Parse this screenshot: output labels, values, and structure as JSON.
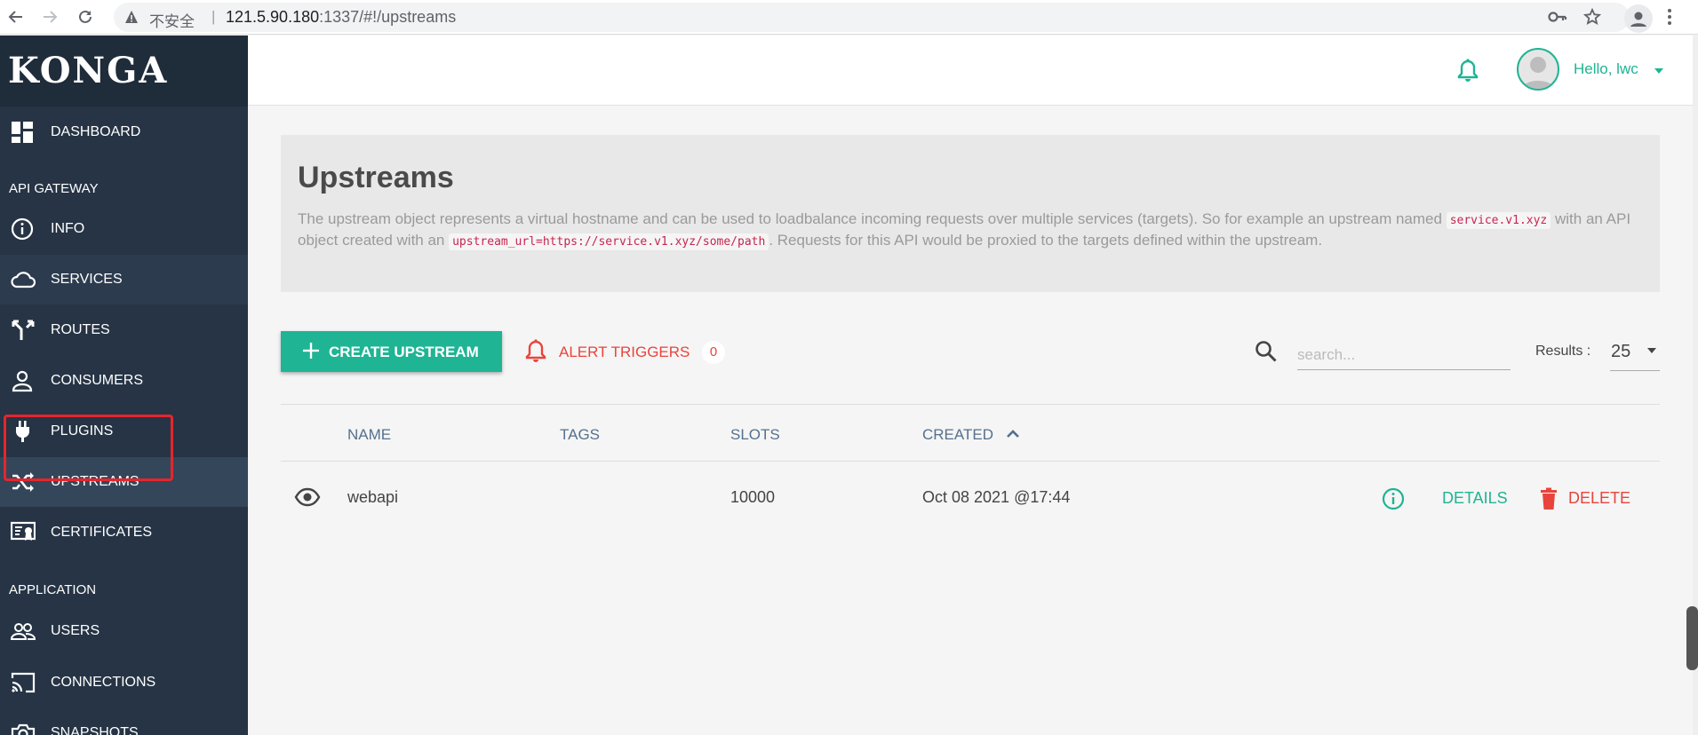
{
  "browser": {
    "insecure_label": "不安全",
    "separator": "|",
    "url_host": "121.5.90.180",
    "url_rest": ":1337/#!/upstreams"
  },
  "sidebar": {
    "logo": "KONGA",
    "dashboard": {
      "label": "DASHBOARD",
      "icon": "dashboard-icon"
    },
    "section_api_gateway": "API GATEWAY",
    "api_items": [
      {
        "label": "INFO",
        "icon": "info-icon"
      },
      {
        "label": "SERVICES",
        "icon": "cloud-icon"
      },
      {
        "label": "ROUTES",
        "icon": "route-fork-icon"
      },
      {
        "label": "CONSUMERS",
        "icon": "person-icon"
      },
      {
        "label": "PLUGINS",
        "icon": "plug-icon"
      },
      {
        "label": "UPSTREAMS",
        "icon": "shuffle-icon"
      },
      {
        "label": "CERTIFICATES",
        "icon": "certificate-icon"
      }
    ],
    "section_application": "APPLICATION",
    "app_items": [
      {
        "label": "USERS",
        "icon": "users-icon"
      },
      {
        "label": "CONNECTIONS",
        "icon": "cast-icon"
      },
      {
        "label": "SNAPSHOTS",
        "icon": "camera-icon"
      }
    ]
  },
  "header": {
    "greeting": "Hello, lwc"
  },
  "page": {
    "title": "Upstreams",
    "desc_part1": "The upstream object represents a virtual hostname and can be used to loadbalance incoming requests over multiple services (targets). So for example an upstream named ",
    "desc_code1": "service.v1.xyz",
    "desc_part2": " with an API object created with an ",
    "desc_code2": "upstream_url=https://service.v1.xyz/some/path",
    "desc_part3": ". Requests for this API would be proxied to the targets defined within the upstream."
  },
  "toolbar": {
    "create_label": "CREATE UPSTREAM",
    "alert_label": "ALERT TRIGGERS",
    "alert_count": "0",
    "search_placeholder": "search...",
    "results_label": "Results :",
    "results_value": "25"
  },
  "table": {
    "headers": {
      "name": "NAME",
      "tags": "TAGS",
      "slots": "SLOTS",
      "created": "CREATED"
    },
    "rows": [
      {
        "name": "webapi",
        "tags": "",
        "slots": "10000",
        "created": "Oct 08 2021 @17:44",
        "details_label": "DETAILS",
        "delete_label": "DELETE"
      }
    ]
  },
  "colors": {
    "sidebar_bg": "#263445",
    "accent_green": "#1fb494",
    "danger_red": "#e8443c",
    "highlight_red": "#e5262d"
  }
}
